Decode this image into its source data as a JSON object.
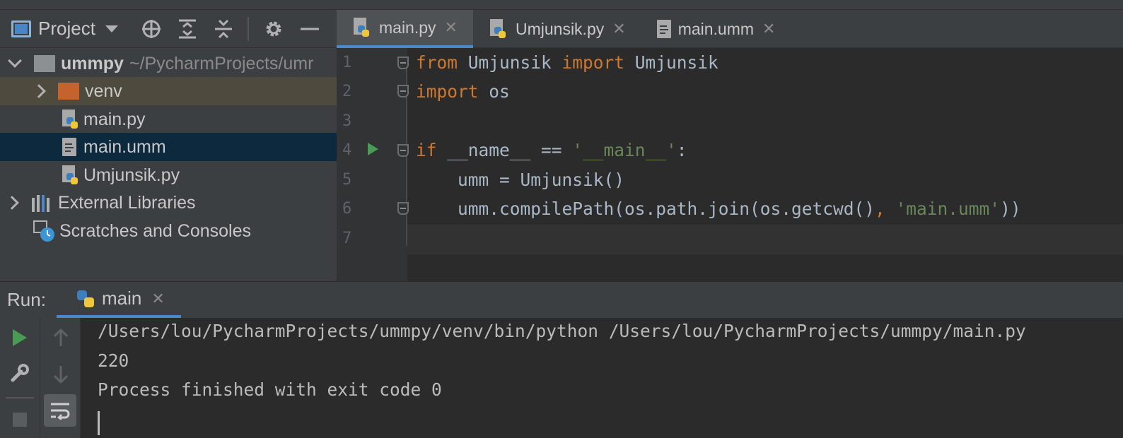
{
  "project_panel": {
    "title": "Project",
    "tree": [
      {
        "label": "ummpy",
        "path": "~/PycharmProjects/umr"
      },
      {
        "label": "venv"
      },
      {
        "label": "main.py"
      },
      {
        "label": "main.umm"
      },
      {
        "label": "Umjunsik.py"
      },
      {
        "label": "External Libraries"
      },
      {
        "label": "Scratches and Consoles"
      }
    ]
  },
  "editor": {
    "tabs": [
      {
        "label": "main.py",
        "active": true
      },
      {
        "label": "Umjunsik.py",
        "active": false
      },
      {
        "label": "main.umm",
        "active": false
      }
    ],
    "line_numbers": [
      "1",
      "2",
      "3",
      "4",
      "5",
      "6",
      "7"
    ],
    "code": {
      "l1_kw1": "from",
      "l1_mod": " Umjunsik ",
      "l1_kw2": "import",
      "l1_name": " Umjunsik",
      "l2_kw": "import",
      "l2_name": " os",
      "l4_kw": "if",
      "l4_mid": " __name__ == ",
      "l4_str": "'__main__'",
      "l4_end": ":",
      "l5": "    umm = Umjunsik()",
      "l6_a": "    umm.compilePath(os.path.join(os.getcwd()",
      "l6_comma": ",",
      "l6_sp": " ",
      "l6_str": "'main.umm'",
      "l6_end": "))"
    }
  },
  "run_panel": {
    "label": "Run:",
    "tab_label": "main",
    "console_lines": [
      "/Users/lou/PycharmProjects/ummpy/venv/bin/python /Users/lou/PycharmProjects/ummpy/main.py",
      "220",
      "Process finished with exit code 0"
    ]
  },
  "colors": {
    "keyword": "#cc7832",
    "string": "#6a8759",
    "selection": "#0d293e",
    "accent": "#4a88c7"
  }
}
